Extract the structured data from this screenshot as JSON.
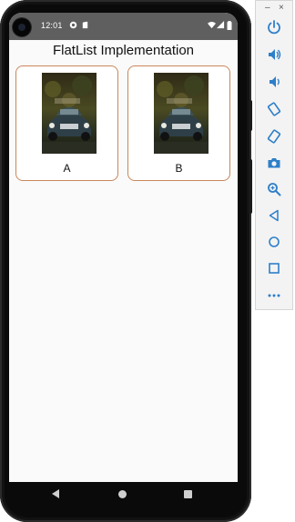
{
  "status_bar": {
    "time": "12:01"
  },
  "app": {
    "title": "FlatList Implementation",
    "items": [
      {
        "label": "A",
        "image": "vintage-car-photo"
      },
      {
        "label": "B",
        "image": "vintage-car-photo"
      }
    ]
  },
  "nav_bar": {
    "icons": [
      "back-icon",
      "home-icon",
      "recents-icon"
    ]
  },
  "emulator_toolbar": {
    "window_controls": {
      "minimize": "–",
      "close": "×"
    },
    "buttons": [
      "power-icon",
      "volume-up-icon",
      "volume-down-icon",
      "rotate-left-icon",
      "rotate-right-icon",
      "camera-icon",
      "zoom-icon",
      "back-icon",
      "home-icon",
      "overview-icon",
      "more-icon"
    ]
  },
  "colors": {
    "status_bar": "#5f5f5f",
    "card_border": "#c8875a",
    "app_background": "#fafafa",
    "toolbar_icon": "#2d7fc9"
  }
}
